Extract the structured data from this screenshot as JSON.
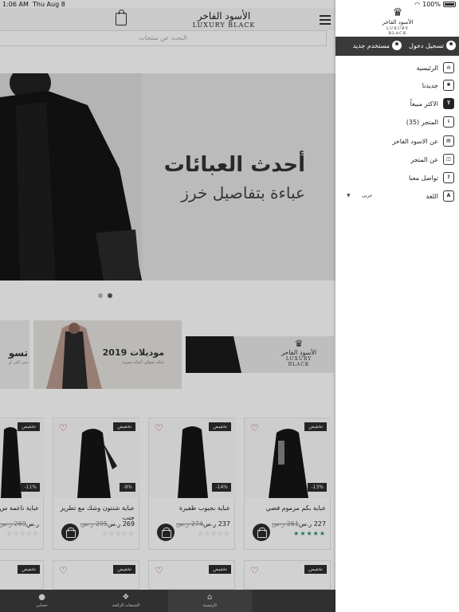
{
  "status": {
    "time": "1:06 AM",
    "date": "Thu Aug 8",
    "battery": "100%"
  },
  "header": {
    "logo_ar": "الأسود الفاخر",
    "logo_en": "LUXURY BLACK"
  },
  "search": {
    "placeholder": "البحث عن منتجات"
  },
  "hero": {
    "title": "أحدث العبائات",
    "subtitle": "عباءة بتفاصيل خرز"
  },
  "banners": [
    {
      "title": "تسو",
      "sub": "متن كاف أو"
    },
    {
      "title": "موديلات 2019",
      "sub": "عباية بحواف أكمام مميزة"
    },
    {
      "logo_ar": "الأسود الفاخر",
      "logo_en": "LUXURY BLACK"
    }
  ],
  "products": [
    {
      "badge": "تخفيض",
      "pct": "-13%",
      "name": "عباية بكم مزموم فضي",
      "price": "227 ر.س",
      "old": "261 ر.س",
      "rating": "★★★★★",
      "rated": true
    },
    {
      "badge": "تخفيض",
      "pct": "-14%",
      "name": "عباية بجيوب ظفيرة",
      "price": "237 ر.س",
      "old": "274 ر.س",
      "rating": "☆☆☆☆☆",
      "rated": false
    },
    {
      "badge": "تخفيض",
      "pct": "-9%",
      "name": "عباية شنتون وشك مع تطريز جنب",
      "price": "269 ر.س",
      "old": "295 ر.س",
      "rating": "☆☆☆☆☆",
      "rated": false
    },
    {
      "badge": "تخفيض",
      "pct": "-11%",
      "name": "عباية ناعمة س امام وكم",
      "price": "ر.س",
      "old": "269 ر.س",
      "rating": "☆☆☆☆☆",
      "rated": false
    }
  ],
  "products_row2": [
    {
      "badge": "تخفيض"
    },
    {
      "badge": "تخفيض"
    },
    {
      "badge": "تخفيض"
    },
    {
      "badge": "تخفيض"
    }
  ],
  "tabs": [
    {
      "label": "حسابي",
      "icon": "user-icon"
    },
    {
      "label": "المنتجات الرائجة",
      "icon": "dropbox-icon"
    },
    {
      "label": "الرئيسية",
      "icon": "home-icon"
    }
  ],
  "drawer": {
    "logo_ar": "الأسود الفاخر",
    "logo_en": "LUXURY BLACK",
    "login": "تسجيل دخول",
    "register": "مستخدم جديد",
    "items": [
      {
        "label": "الرئيسية",
        "icon": "home-icon"
      },
      {
        "label": "جديدنا",
        "icon": "new-badge-icon"
      },
      {
        "label": "الاكثر مبيعاً",
        "icon": "top-badge-icon"
      },
      {
        "label": "المتجر (35)",
        "icon": "store-items-icon"
      },
      {
        "label": "عن الاسود الفاخر",
        "icon": "shop-icon"
      },
      {
        "label": "عن المتجر",
        "icon": "bag-icon"
      },
      {
        "label": "تواصل معنا",
        "icon": "contact-icon"
      },
      {
        "label": "اللغة",
        "icon": "language-icon"
      }
    ],
    "language_value": "عربى"
  }
}
